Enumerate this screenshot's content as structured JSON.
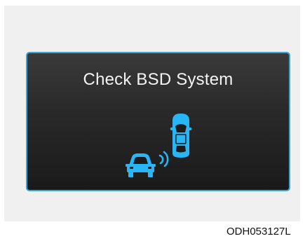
{
  "display": {
    "message": "Check BSD System",
    "accent_color": "#3aa3d4",
    "icon_color": "#29b6f6",
    "icons": [
      "vehicle-rear-icon",
      "radar-wave-icon",
      "vehicle-top-icon"
    ]
  },
  "footer": {
    "code": "ODH053127L"
  }
}
